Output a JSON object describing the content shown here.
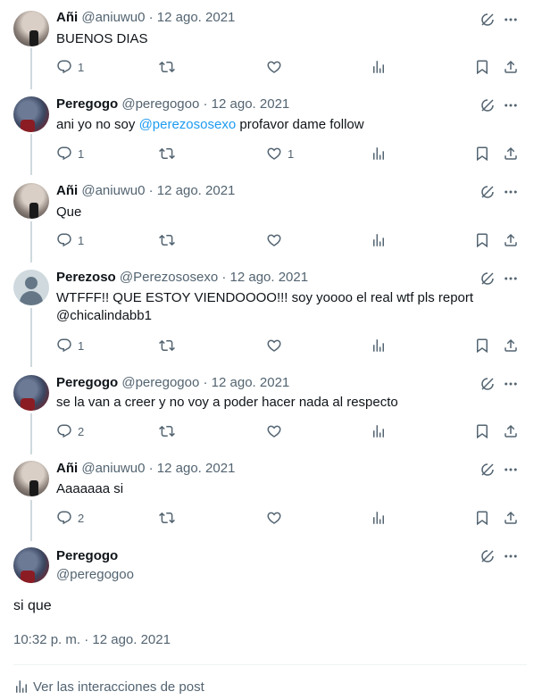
{
  "tweets": [
    {
      "name": "Añi",
      "handle": "@aniuwu0",
      "date": "12 ago. 2021",
      "text": "BUENOS DIAS",
      "replies": "1",
      "retweets": "",
      "likes": "",
      "avatar": "ani"
    },
    {
      "name": "Peregogo",
      "handle": "@peregogoo",
      "date": "12 ago. 2021",
      "text_before": "ani yo no soy ",
      "mention": "@perezososexo",
      "text_after": " profavor dame follow",
      "replies": "1",
      "retweets": "",
      "likes": "1",
      "avatar": "pere"
    },
    {
      "name": "Añi",
      "handle": "@aniuwu0",
      "date": "12 ago. 2021",
      "text": "Que",
      "replies": "1",
      "retweets": "",
      "likes": "",
      "avatar": "ani"
    },
    {
      "name": "Perezoso",
      "handle": "@Perezososexo",
      "date": "12 ago. 2021",
      "text": "WTFFF!! QUE ESTOY VIENDOOOO!!! soy yoooo el real wtf pls report @chicalindabb1",
      "replies": "1",
      "retweets": "",
      "likes": "",
      "avatar": "default"
    },
    {
      "name": "Peregogo",
      "handle": "@peregogoo",
      "date": "12 ago. 2021",
      "text": "se la van a creer y no voy a poder hacer nada al respecto",
      "replies": "2",
      "retweets": "",
      "likes": "",
      "avatar": "pere"
    },
    {
      "name": "Añi",
      "handle": "@aniuwu0",
      "date": "12 ago. 2021",
      "text": "Aaaaaaa si",
      "replies": "2",
      "retweets": "",
      "likes": "",
      "avatar": "ani"
    }
  ],
  "main": {
    "name": "Peregogo",
    "handle": "@peregogoo",
    "text": "si que",
    "timestamp": "10:32 p. m. · 12 ago. 2021",
    "interactions_label": "Ver las interacciones de post"
  },
  "separator": " · ",
  "icons": [
    "reply-icon",
    "retweet-icon",
    "like-icon",
    "views-icon",
    "bookmark-icon",
    "share-icon",
    "grok-icon",
    "more-icon"
  ],
  "colors": {
    "text": "#0f1419",
    "secondary": "#536471",
    "link": "#1d9bf0",
    "thread": "#cfd9de"
  }
}
